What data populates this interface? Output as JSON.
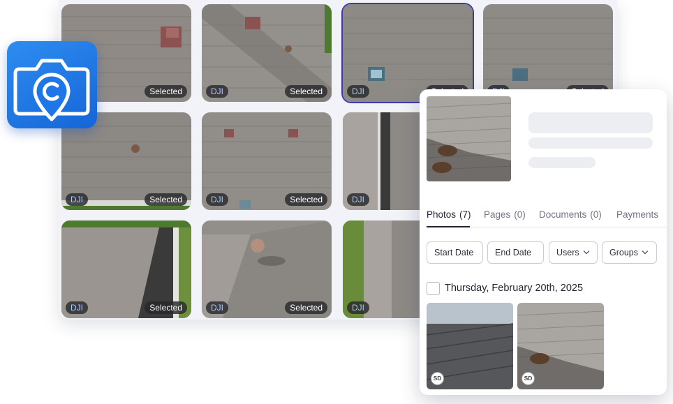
{
  "colors": {
    "accent": "#3f3aa8",
    "app_icon_blue": "#1f76e6",
    "pill_dji_text": "#aac8ff"
  },
  "app_icon": {
    "icon": "camera-location-pin-icon"
  },
  "grid": {
    "tiles": [
      {
        "dji": "",
        "selected": "Selected",
        "is_selected": false
      },
      {
        "dji": "DJI",
        "selected": "Selected",
        "is_selected": false
      },
      {
        "dji": "DJI",
        "selected": "Selected",
        "is_selected": true
      },
      {
        "dji": "DJI",
        "selected": "Selected",
        "is_selected": false
      },
      {
        "dji": "DJI",
        "selected": "Selected",
        "is_selected": false
      },
      {
        "dji": "DJI",
        "selected": "Selected",
        "is_selected": false
      },
      {
        "dji": "DJI",
        "selected": "",
        "is_selected": false
      },
      {
        "dji": "",
        "selected": "",
        "is_selected": false
      },
      {
        "dji": "DJI",
        "selected": "Selected",
        "is_selected": false
      },
      {
        "dji": "DJI",
        "selected": "Selected",
        "is_selected": false
      },
      {
        "dji": "DJI",
        "selected": "",
        "is_selected": false
      },
      {
        "dji": "",
        "selected": "",
        "is_selected": false
      }
    ]
  },
  "detail": {
    "tabs": [
      {
        "label": "Photos",
        "count": "(7)"
      },
      {
        "label": "Pages",
        "count": "(0)"
      },
      {
        "label": "Documents",
        "count": "(0)"
      },
      {
        "label": "Payments",
        "count": ""
      }
    ],
    "filters": {
      "start_date": "Start Date",
      "end_date": "End Date",
      "users": "Users",
      "groups": "Groups"
    },
    "date_group": "Thursday, February 20th, 2025",
    "photos": [
      {
        "avatar": "SD"
      },
      {
        "avatar": "SD"
      }
    ]
  }
}
